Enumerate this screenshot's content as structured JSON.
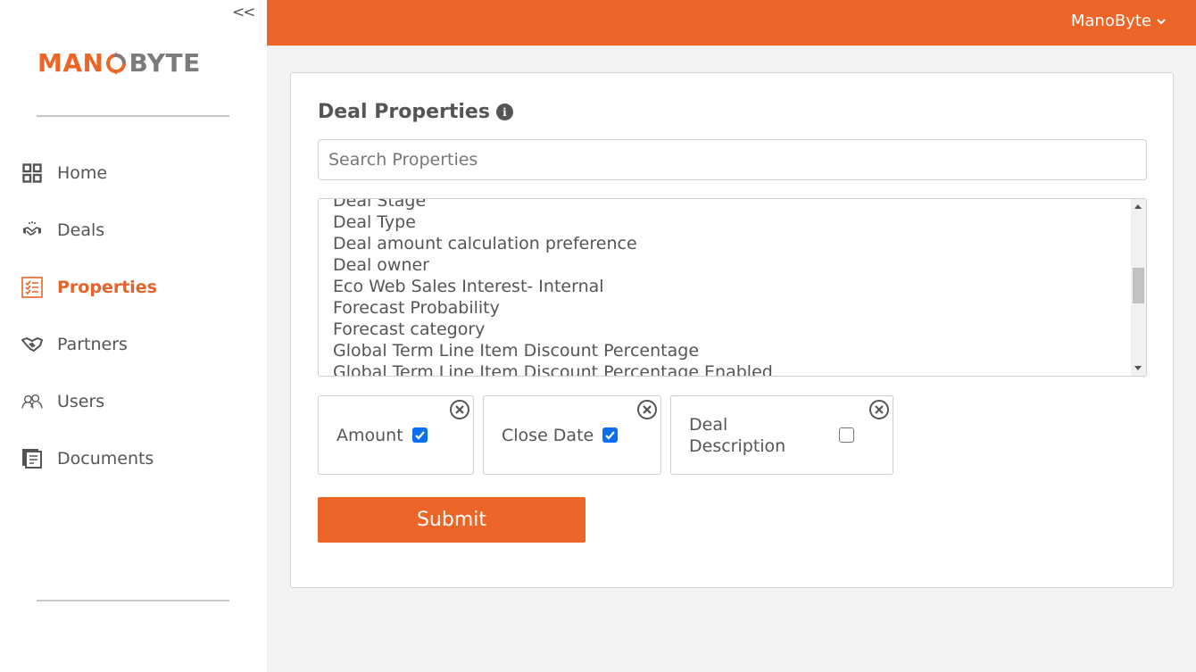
{
  "sidebar": {
    "collapse_label": "<<",
    "logo": {
      "left": "MAN",
      "right": "BYTE"
    },
    "items": [
      {
        "label": "Home",
        "icon": "grid-icon",
        "active": false
      },
      {
        "label": "Deals",
        "icon": "handshake-icon",
        "active": false
      },
      {
        "label": "Properties",
        "icon": "checklist-icon",
        "active": true
      },
      {
        "label": "Partners",
        "icon": "handshake-icon",
        "active": false
      },
      {
        "label": "Users",
        "icon": "users-icon",
        "active": false
      },
      {
        "label": "Documents",
        "icon": "documents-icon",
        "active": false
      }
    ]
  },
  "topbar": {
    "user_name": "ManoByte"
  },
  "colors": {
    "brand": "#ec6426",
    "checkbox": "#0b6ff0"
  },
  "main": {
    "title": "Deal Properties",
    "search": {
      "placeholder": "Search Properties",
      "value": ""
    },
    "property_list": [
      "Deal Stage",
      "Deal Type",
      "Deal amount calculation preference",
      "Deal owner",
      "Eco Web Sales Interest- Internal",
      "Forecast Probability",
      "Forecast category",
      "Global Term Line Item Discount Percentage",
      "Global Term Line Item Discount Percentage Enabled"
    ],
    "selected": [
      {
        "label": "Amount",
        "checked": true
      },
      {
        "label": "Close Date",
        "checked": true
      },
      {
        "label": "Deal Description",
        "checked": false
      }
    ],
    "submit_label": "Submit"
  }
}
